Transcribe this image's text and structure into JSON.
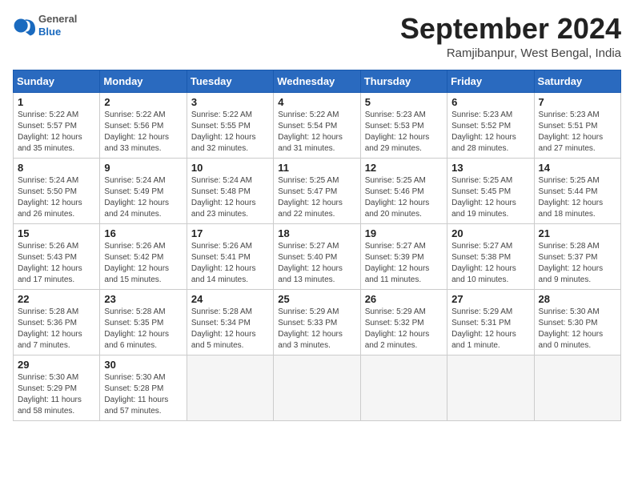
{
  "header": {
    "logo": {
      "general": "General",
      "blue": "Blue"
    },
    "title": "September 2024",
    "location": "Ramjibanpur, West Bengal, India"
  },
  "columns": [
    "Sunday",
    "Monday",
    "Tuesday",
    "Wednesday",
    "Thursday",
    "Friday",
    "Saturday"
  ],
  "weeks": [
    [
      {
        "day": 1,
        "sunrise": "5:22 AM",
        "sunset": "5:57 PM",
        "daylight": "12 hours and 35 minutes."
      },
      {
        "day": 2,
        "sunrise": "5:22 AM",
        "sunset": "5:56 PM",
        "daylight": "12 hours and 33 minutes."
      },
      {
        "day": 3,
        "sunrise": "5:22 AM",
        "sunset": "5:55 PM",
        "daylight": "12 hours and 32 minutes."
      },
      {
        "day": 4,
        "sunrise": "5:22 AM",
        "sunset": "5:54 PM",
        "daylight": "12 hours and 31 minutes."
      },
      {
        "day": 5,
        "sunrise": "5:23 AM",
        "sunset": "5:53 PM",
        "daylight": "12 hours and 29 minutes."
      },
      {
        "day": 6,
        "sunrise": "5:23 AM",
        "sunset": "5:52 PM",
        "daylight": "12 hours and 28 minutes."
      },
      {
        "day": 7,
        "sunrise": "5:23 AM",
        "sunset": "5:51 PM",
        "daylight": "12 hours and 27 minutes."
      }
    ],
    [
      {
        "day": 8,
        "sunrise": "5:24 AM",
        "sunset": "5:50 PM",
        "daylight": "12 hours and 26 minutes."
      },
      {
        "day": 9,
        "sunrise": "5:24 AM",
        "sunset": "5:49 PM",
        "daylight": "12 hours and 24 minutes."
      },
      {
        "day": 10,
        "sunrise": "5:24 AM",
        "sunset": "5:48 PM",
        "daylight": "12 hours and 23 minutes."
      },
      {
        "day": 11,
        "sunrise": "5:25 AM",
        "sunset": "5:47 PM",
        "daylight": "12 hours and 22 minutes."
      },
      {
        "day": 12,
        "sunrise": "5:25 AM",
        "sunset": "5:46 PM",
        "daylight": "12 hours and 20 minutes."
      },
      {
        "day": 13,
        "sunrise": "5:25 AM",
        "sunset": "5:45 PM",
        "daylight": "12 hours and 19 minutes."
      },
      {
        "day": 14,
        "sunrise": "5:25 AM",
        "sunset": "5:44 PM",
        "daylight": "12 hours and 18 minutes."
      }
    ],
    [
      {
        "day": 15,
        "sunrise": "5:26 AM",
        "sunset": "5:43 PM",
        "daylight": "12 hours and 17 minutes."
      },
      {
        "day": 16,
        "sunrise": "5:26 AM",
        "sunset": "5:42 PM",
        "daylight": "12 hours and 15 minutes."
      },
      {
        "day": 17,
        "sunrise": "5:26 AM",
        "sunset": "5:41 PM",
        "daylight": "12 hours and 14 minutes."
      },
      {
        "day": 18,
        "sunrise": "5:27 AM",
        "sunset": "5:40 PM",
        "daylight": "12 hours and 13 minutes."
      },
      {
        "day": 19,
        "sunrise": "5:27 AM",
        "sunset": "5:39 PM",
        "daylight": "12 hours and 11 minutes."
      },
      {
        "day": 20,
        "sunrise": "5:27 AM",
        "sunset": "5:38 PM",
        "daylight": "12 hours and 10 minutes."
      },
      {
        "day": 21,
        "sunrise": "5:28 AM",
        "sunset": "5:37 PM",
        "daylight": "12 hours and 9 minutes."
      }
    ],
    [
      {
        "day": 22,
        "sunrise": "5:28 AM",
        "sunset": "5:36 PM",
        "daylight": "12 hours and 7 minutes."
      },
      {
        "day": 23,
        "sunrise": "5:28 AM",
        "sunset": "5:35 PM",
        "daylight": "12 hours and 6 minutes."
      },
      {
        "day": 24,
        "sunrise": "5:28 AM",
        "sunset": "5:34 PM",
        "daylight": "12 hours and 5 minutes."
      },
      {
        "day": 25,
        "sunrise": "5:29 AM",
        "sunset": "5:33 PM",
        "daylight": "12 hours and 3 minutes."
      },
      {
        "day": 26,
        "sunrise": "5:29 AM",
        "sunset": "5:32 PM",
        "daylight": "12 hours and 2 minutes."
      },
      {
        "day": 27,
        "sunrise": "5:29 AM",
        "sunset": "5:31 PM",
        "daylight": "12 hours and 1 minute."
      },
      {
        "day": 28,
        "sunrise": "5:30 AM",
        "sunset": "5:30 PM",
        "daylight": "12 hours and 0 minutes."
      }
    ],
    [
      {
        "day": 29,
        "sunrise": "5:30 AM",
        "sunset": "5:29 PM",
        "daylight": "11 hours and 58 minutes."
      },
      {
        "day": 30,
        "sunrise": "5:30 AM",
        "sunset": "5:28 PM",
        "daylight": "11 hours and 57 minutes."
      },
      null,
      null,
      null,
      null,
      null
    ]
  ]
}
